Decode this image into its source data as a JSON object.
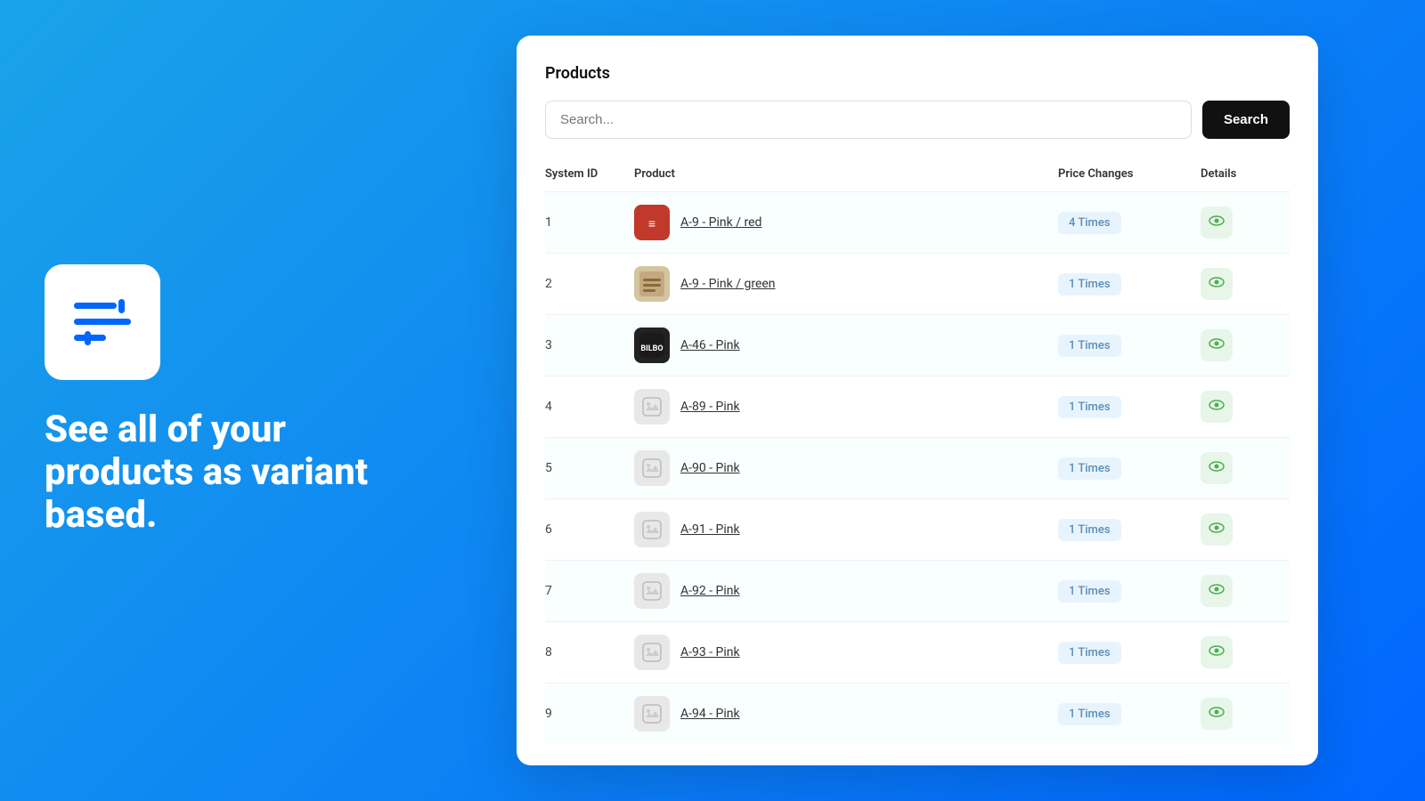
{
  "left": {
    "tagline": "See all of your products as variant based."
  },
  "card": {
    "title": "Products",
    "search": {
      "placeholder": "Search...",
      "button_label": "Search"
    },
    "table": {
      "headers": [
        {
          "key": "system_id",
          "label": "System ID"
        },
        {
          "key": "product",
          "label": "Product"
        },
        {
          "key": "price_changes",
          "label": "Price Changes"
        },
        {
          "key": "details",
          "label": "Details"
        }
      ],
      "rows": [
        {
          "id": "1",
          "name": "A-9 - Pink / red",
          "price_changes": "4 Times",
          "thumb_type": "red",
          "has_image": true
        },
        {
          "id": "2",
          "name": "A-9 - Pink / green",
          "price_changes": "1 Times",
          "thumb_type": "beige",
          "has_image": true
        },
        {
          "id": "3",
          "name": "A-46 - Pink",
          "price_changes": "1 Times",
          "thumb_type": "dark",
          "has_image": true
        },
        {
          "id": "4",
          "name": "A-89 - Pink",
          "price_changes": "1 Times",
          "thumb_type": "placeholder",
          "has_image": false
        },
        {
          "id": "5",
          "name": "A-90 - Pink",
          "price_changes": "1 Times",
          "thumb_type": "placeholder",
          "has_image": false
        },
        {
          "id": "6",
          "name": "A-91 - Pink",
          "price_changes": "1 Times",
          "thumb_type": "placeholder",
          "has_image": false
        },
        {
          "id": "7",
          "name": "A-92 - Pink",
          "price_changes": "1 Times",
          "thumb_type": "placeholder",
          "has_image": false
        },
        {
          "id": "8",
          "name": "A-93 - Pink",
          "price_changes": "1 Times",
          "thumb_type": "placeholder",
          "has_image": false
        },
        {
          "id": "9",
          "name": "A-94 - Pink",
          "price_changes": "1 Times",
          "thumb_type": "placeholder",
          "has_image": false
        }
      ]
    }
  }
}
